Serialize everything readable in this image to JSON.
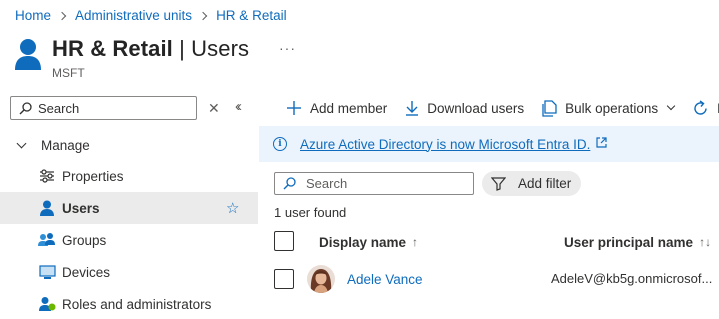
{
  "breadcrumb": [
    "Home",
    "Administrative units",
    "HR & Retail"
  ],
  "header": {
    "title_bold": "HR & Retail",
    "title_rest": " | Users",
    "subtitle": "MSFT",
    "more": "···"
  },
  "sidebar": {
    "search_placeholder": "Search",
    "group_label": "Manage",
    "items": [
      {
        "label": "Properties",
        "icon": "properties-icon",
        "active": false
      },
      {
        "label": "Users",
        "icon": "user-icon",
        "active": true
      },
      {
        "label": "Groups",
        "icon": "groups-icon",
        "active": false
      },
      {
        "label": "Devices",
        "icon": "devices-icon",
        "active": false
      },
      {
        "label": "Roles and administrators",
        "icon": "roles-icon",
        "active": false
      }
    ]
  },
  "toolbar": {
    "add_member": "Add member",
    "download_users": "Download users",
    "bulk_operations": "Bulk operations",
    "refresh": "Re"
  },
  "info_bar": {
    "message": "Azure Active Directory is now Microsoft Entra ID."
  },
  "main": {
    "search_placeholder": "Search",
    "add_filter": "Add filter",
    "count_text": "1 user found",
    "columns": {
      "display_name": "Display name",
      "display_name_sort": "↑",
      "upn": "User principal name",
      "upn_sort": "↑↓"
    },
    "rows": [
      {
        "display_name": "Adele Vance",
        "upn": "AdeleV@kb5g.onmicrosof..."
      }
    ]
  },
  "colors": {
    "accent": "#0f6cbd",
    "active_bg": "#ebebeb",
    "info_bg": "#ebf3fc"
  }
}
